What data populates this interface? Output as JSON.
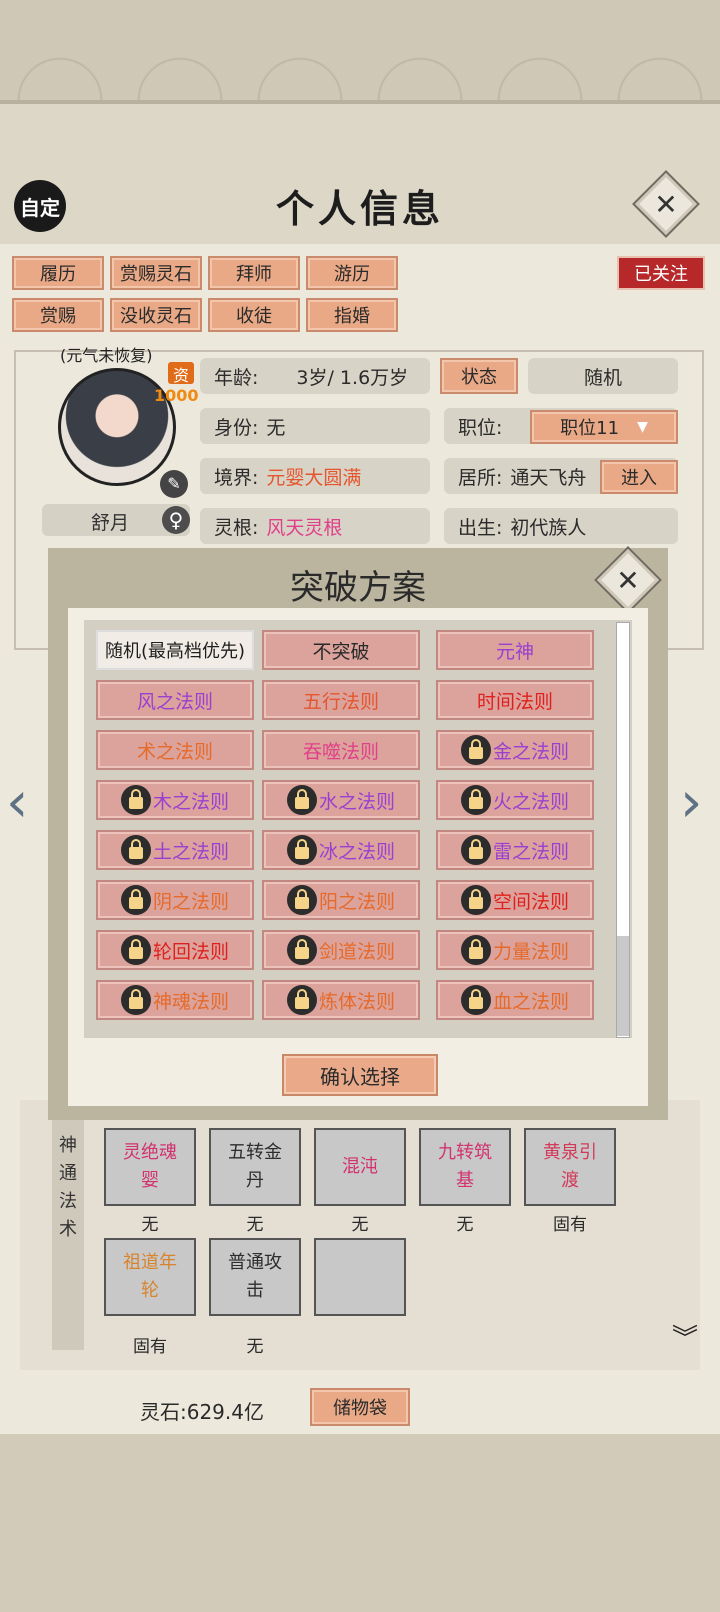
{
  "header": {
    "title": "个人信息",
    "custom_label": "自定"
  },
  "actions": {
    "row1": [
      "履历",
      "赏赐灵石",
      "拜师",
      "游历"
    ],
    "row2": [
      "赏赐",
      "没收灵石",
      "收徒",
      "指婚"
    ],
    "followed": "已关注"
  },
  "profile": {
    "spirit_status": "(元气未恢复)",
    "aptitude_label": "资",
    "aptitude_value": "1000",
    "name": "舒月",
    "gender_symbol": "♀",
    "age_label": "年龄:",
    "age_value": "3岁/ 1.6万岁",
    "status_button": "状态",
    "random_button": "随机",
    "identity_label": "身份:",
    "identity_value": "无",
    "position_label": "职位:",
    "position_value": "职位11",
    "realm_label": "境界:",
    "realm_value": "元婴大圆满",
    "residence_label": "居所:",
    "residence_value": "通天飞舟",
    "enter_button": "进入",
    "root_label": "灵根:",
    "root_value": "风天灵根",
    "origin_label": "出生:",
    "origin_value": "初代族人"
  },
  "dialog": {
    "title": "突破方案",
    "confirm": "确认选择",
    "options": [
      {
        "label": "随机(最高档优先)",
        "color": "#1e1e1e",
        "locked": false,
        "selected": true
      },
      {
        "label": "不突破",
        "color": "#2a2a2a",
        "locked": false
      },
      {
        "label": "元神",
        "color": "#9b3fd1",
        "locked": false
      },
      {
        "label": "风之法则",
        "color": "#9b3fd1",
        "locked": false
      },
      {
        "label": "五行法则",
        "color": "#e4562e",
        "locked": false
      },
      {
        "label": "时间法则",
        "color": "#e0201e",
        "locked": false
      },
      {
        "label": "术之法则",
        "color": "#e66a2a",
        "locked": false
      },
      {
        "label": "吞噬法则",
        "color": "#e0408a",
        "locked": false
      },
      {
        "label": "金之法则",
        "color": "#9b3fd1",
        "locked": true
      },
      {
        "label": "木之法则",
        "color": "#9b3fd1",
        "locked": true
      },
      {
        "label": "水之法则",
        "color": "#9b3fd1",
        "locked": true
      },
      {
        "label": "火之法则",
        "color": "#9b3fd1",
        "locked": true
      },
      {
        "label": "土之法则",
        "color": "#9b3fd1",
        "locked": true
      },
      {
        "label": "冰之法则",
        "color": "#9b3fd1",
        "locked": true
      },
      {
        "label": "雷之法则",
        "color": "#9b3fd1",
        "locked": true
      },
      {
        "label": "阴之法则",
        "color": "#e66a2a",
        "locked": true
      },
      {
        "label": "阳之法则",
        "color": "#e66a2a",
        "locked": true
      },
      {
        "label": "空间法则",
        "color": "#e0201e",
        "locked": true
      },
      {
        "label": "轮回法则",
        "color": "#e0201e",
        "locked": true
      },
      {
        "label": "剑道法则",
        "color": "#e66a2a",
        "locked": true
      },
      {
        "label": "力量法则",
        "color": "#e66a2a",
        "locked": true
      },
      {
        "label": "神魂法则",
        "color": "#e66a2a",
        "locked": true
      },
      {
        "label": "炼体法则",
        "color": "#e66a2a",
        "locked": true
      },
      {
        "label": "血之法则",
        "color": "#e66a2a",
        "locked": true
      }
    ]
  },
  "skills": {
    "section_label": "神通法术",
    "items": [
      {
        "name": "灵绝魂婴",
        "status": "无",
        "color": "#d2326e"
      },
      {
        "name": "五转金丹",
        "status": "无",
        "color": "#2d2d2d"
      },
      {
        "name": "混沌",
        "status": "无",
        "color": "#d2326e"
      },
      {
        "name": "九转筑基",
        "status": "无",
        "color": "#d2326e"
      },
      {
        "name": "黄泉引渡",
        "status": "固有",
        "color": "#d23a5a"
      },
      {
        "name": "祖道年轮",
        "status": "固有",
        "color": "#d8842f"
      },
      {
        "name": "普通攻击",
        "status": "无",
        "color": "#2d2d2d"
      },
      {
        "name": "",
        "status": "",
        "color": "#2d2d2d"
      }
    ]
  },
  "footer": {
    "stone_label": "灵石:629.4亿",
    "storage_button": "储物袋"
  }
}
